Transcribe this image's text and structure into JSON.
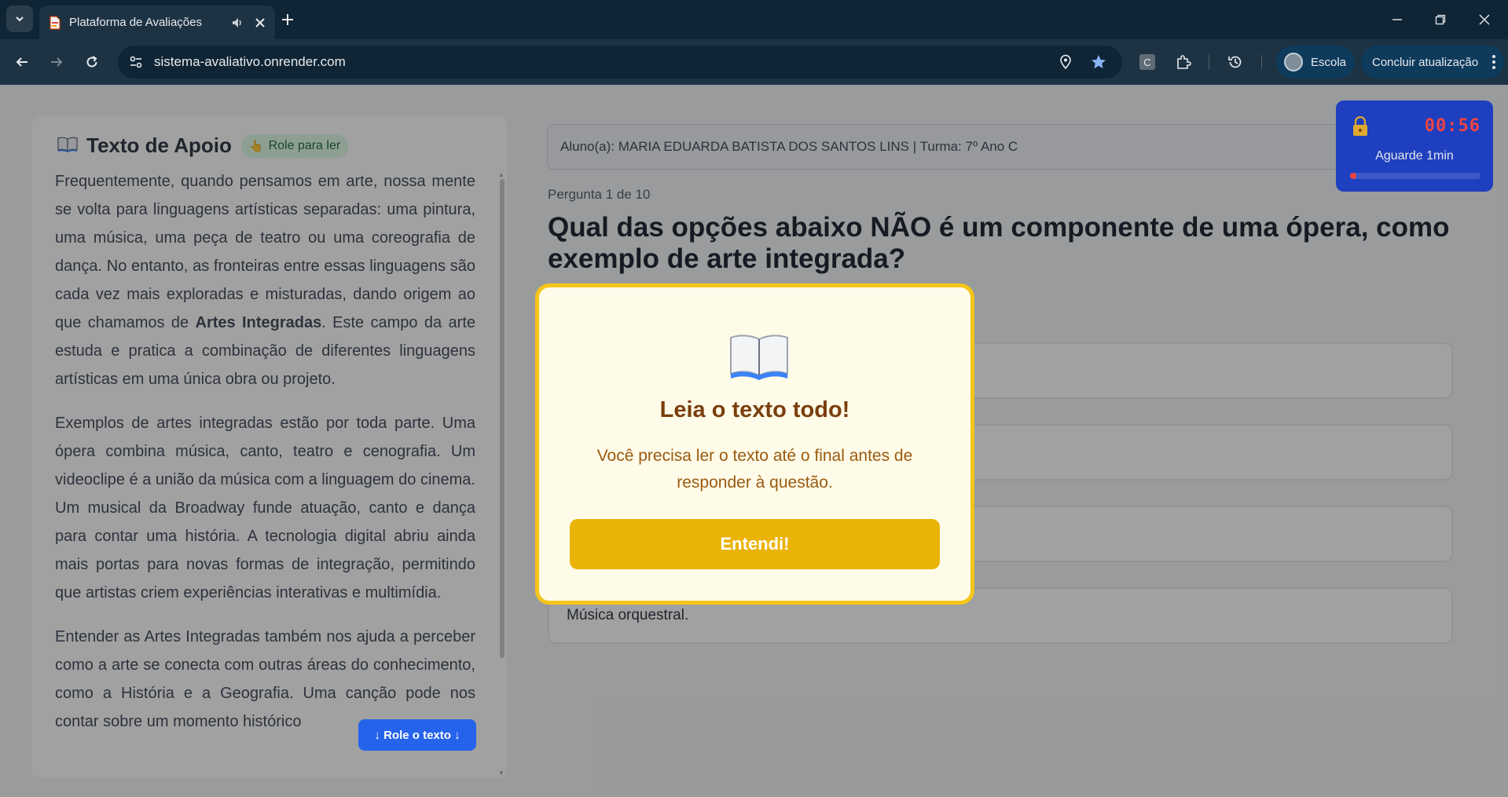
{
  "browser": {
    "tab_title": "Plataforma de Avaliações",
    "url": "sistema-avaliativo.onrender.com",
    "profile_label": "Escola",
    "update_label": "Concluir atualização",
    "extension_letter": "C"
  },
  "support": {
    "title": "Texto de Apoio",
    "badge": "Role para ler",
    "paragraphs": [
      {
        "before": "Frequentemente, quando pensamos em arte, nossa mente se volta para linguagens artísticas separadas: uma pintura, uma música, uma peça de teatro ou uma coreografia de dança. No entanto, as fronteiras entre essas linguagens são cada vez mais exploradas e misturadas, dando origem ao que chamamos de ",
        "bold": "Artes Integradas",
        "after": ". Este campo da arte estuda e pratica a combinação de diferentes linguagens artísticas em uma única obra ou projeto."
      },
      {
        "text": "Exemplos de artes integradas estão por toda parte. Uma ópera combina música, canto, teatro e cenografia. Um videoclipe é a união da música com a linguagem do cinema. Um musical da Broadway funde atuação, canto e dança para contar uma história. A tecnologia digital abriu ainda mais portas para novas formas de integração, permitindo que artistas criem experiências interativas e multimídia."
      },
      {
        "text": "Entender as Artes Integradas também nos ajuda a perceber como a arte se conecta com outras áreas do conhecimento, como a História e a Geografia. Uma canção pode nos contar sobre um momento histórico"
      }
    ],
    "scroll_hint": "↓ Role o texto ↓"
  },
  "student": {
    "info": "Aluno(a): MARIA EDUARDA BATISTA DOS SANTOS LINS | Turma: 7º Ano C"
  },
  "question": {
    "counter": "Pergunta 1 de 10",
    "text": "Qual das opções abaixo NÃO é um componente de uma ópera, como exemplo de arte integrada?",
    "options": [
      "",
      "",
      "",
      "Música orquestral."
    ]
  },
  "timer": {
    "time": "00:56",
    "wait_label": "Aguarde 1min",
    "progress": 0.03
  },
  "modal": {
    "title": "Leia o texto todo!",
    "message": "Você precisa ler o texto até o final antes de responder à questão.",
    "button": "Entendi!"
  },
  "colors": {
    "modal_border": "#f5c518",
    "modal_button": "#eab308",
    "timer_bg": "#1e3fbf",
    "timer_text": "#ef4444",
    "badge_bg": "#dcfce7"
  }
}
